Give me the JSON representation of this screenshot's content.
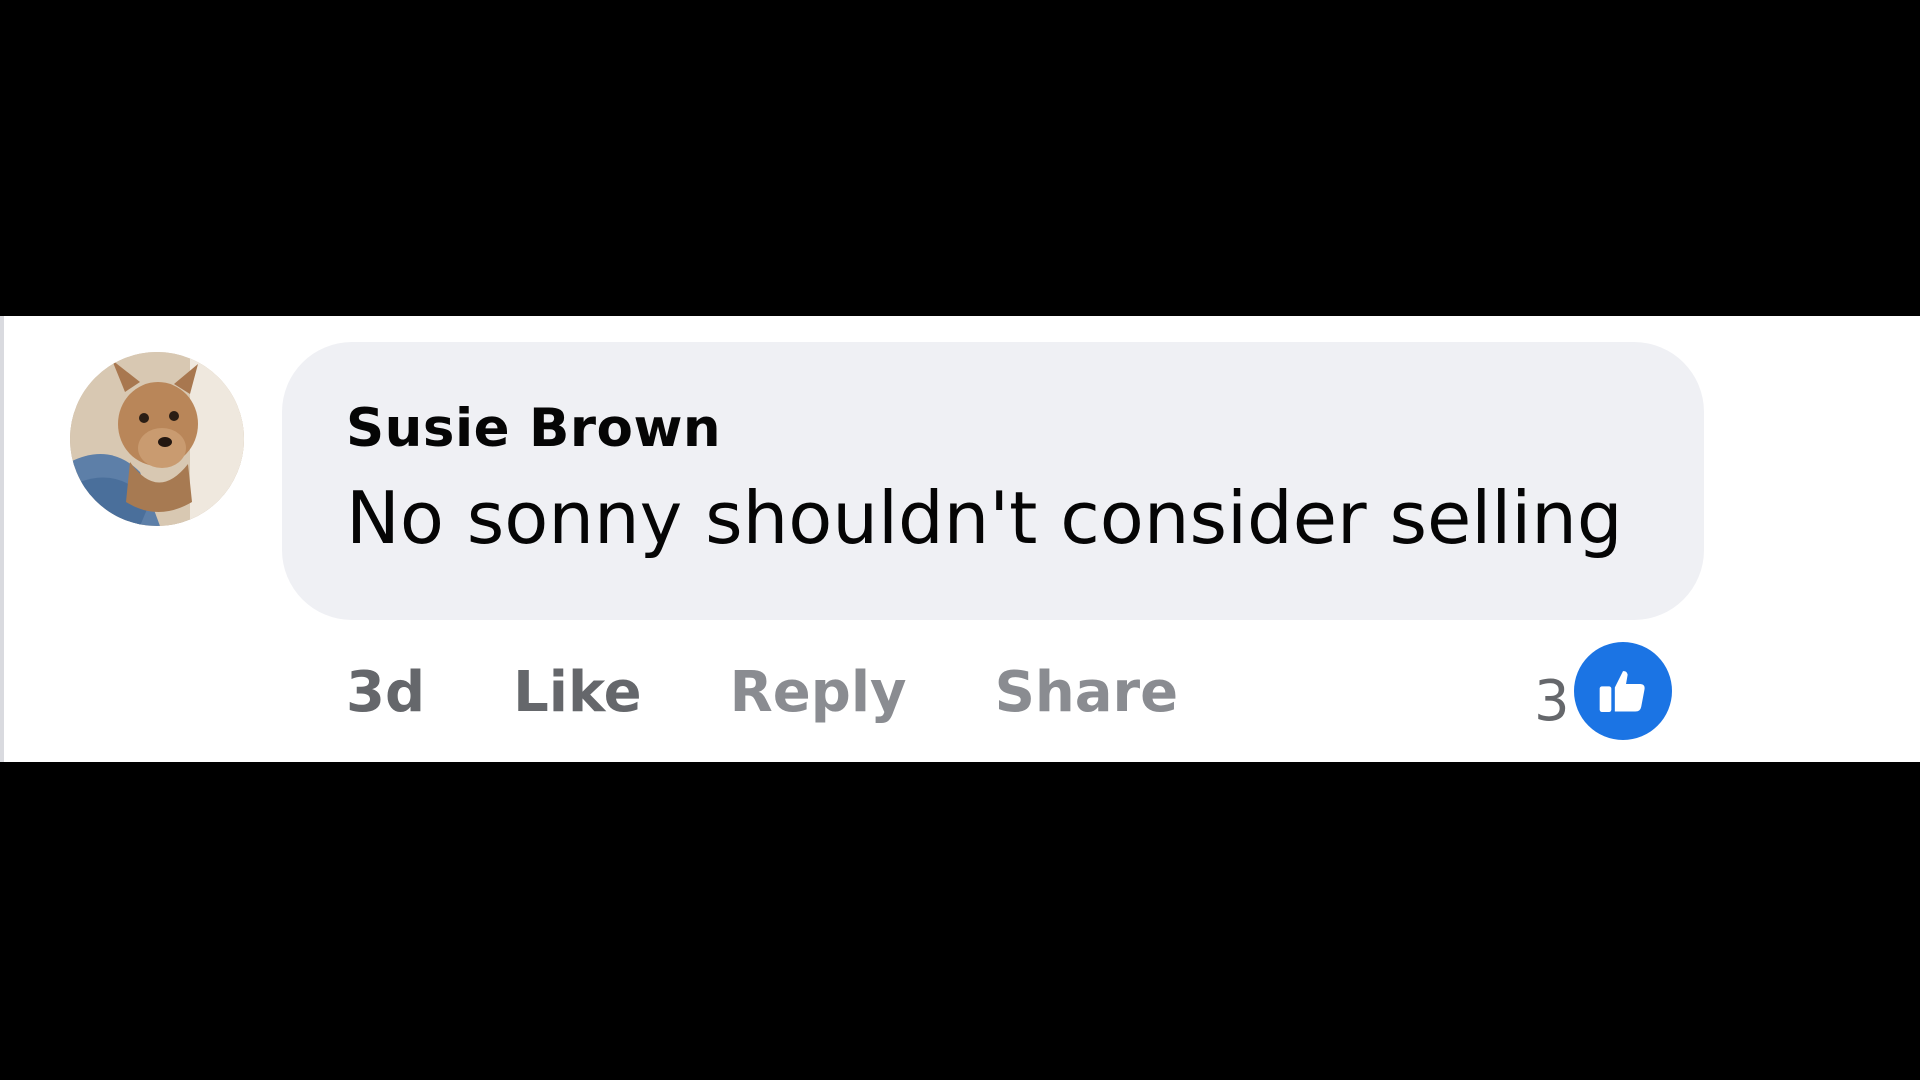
{
  "comment": {
    "author": "Susie Brown",
    "text": "No sonny shouldn't consider selling",
    "time": "3d",
    "actions": {
      "like": "Like",
      "reply": "Reply",
      "share": "Share"
    },
    "reactions": {
      "count": "3",
      "type_icon": "thumbs-up-icon",
      "badge_color": "#1b74e4"
    },
    "avatar_icon": "dog-photo-avatar"
  }
}
